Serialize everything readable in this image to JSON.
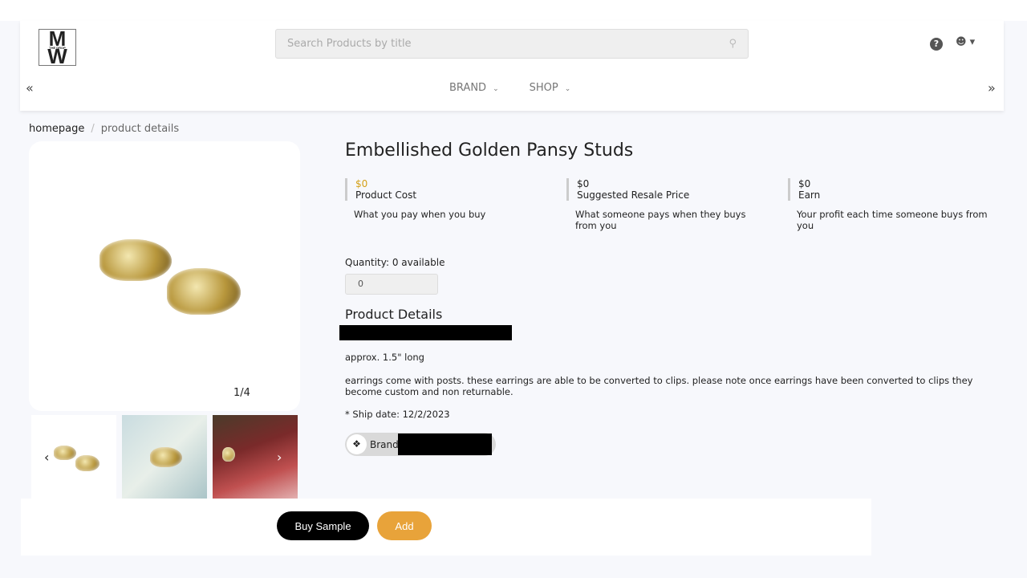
{
  "header": {
    "logo_text": "MW",
    "logo_subtext": "THE DROP",
    "search_placeholder": "Search Products by title",
    "nav": [
      {
        "label": "BRAND"
      },
      {
        "label": "SHOP"
      }
    ]
  },
  "breadcrumb": {
    "home": "homepage",
    "current": "product details"
  },
  "gallery": {
    "counter": "1/4"
  },
  "product": {
    "title": "Embellished Golden Pansy Studs",
    "prices": [
      {
        "value": "$0",
        "label": "Product Cost",
        "desc": "What you pay when you buy",
        "color": "#d4a017"
      },
      {
        "value": "$0",
        "label": "Suggested Resale Price",
        "desc": "What someone pays when they buys from you"
      },
      {
        "value": "$0",
        "label": "Earn",
        "desc": "Your profit each time someone buys from you"
      }
    ],
    "quantity_label": "Quantity: 0 available",
    "quantity_value": "0",
    "details_heading": "Product Details",
    "details": [
      "approx. 1.5\" long",
      "earrings come with posts. these earrings are able to be converted to clips. please note once earrings have been converted to clips they become custom and non returnable.",
      "* Ship date: 12/2/2023"
    ],
    "brand_label": "Brand:"
  },
  "actions": {
    "buy_sample": "Buy Sample",
    "add": "Add",
    "add_color": "#e8a33a"
  }
}
